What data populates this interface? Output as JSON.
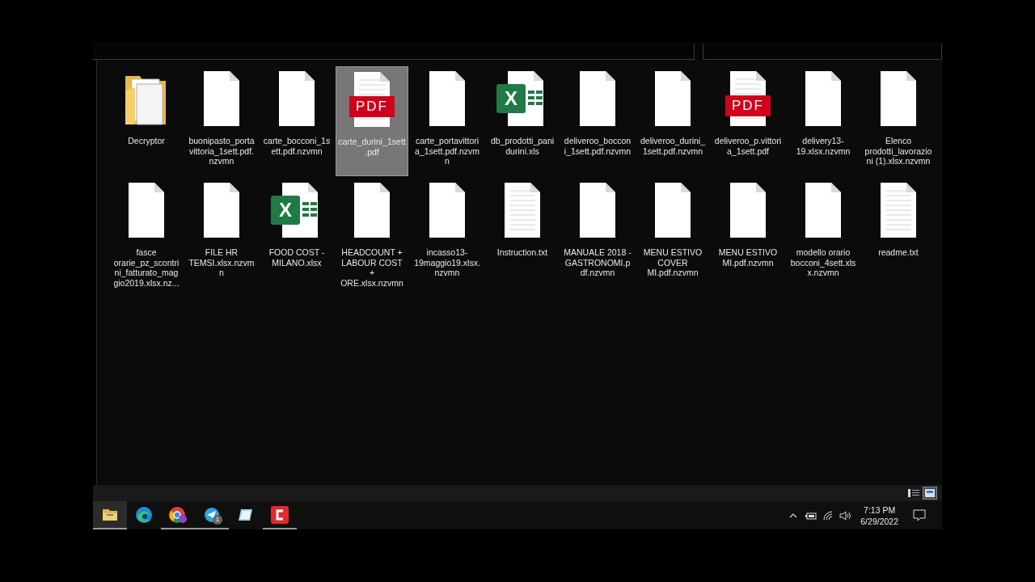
{
  "files": [
    {
      "name": "Decryptor",
      "kind": "folder",
      "selected": false
    },
    {
      "name": "buonipasto_portavittoria_1sett.pdf.nzvmn",
      "kind": "blank",
      "selected": false
    },
    {
      "name": "carte_bocconi_1sett.pdf.nzvmn",
      "kind": "blank",
      "selected": false
    },
    {
      "name": "carte_durini_1sett.pdf",
      "kind": "pdf",
      "icon_label": "PDF",
      "selected": true
    },
    {
      "name": "carte_portavittoria_1sett.pdf.nzvmn",
      "kind": "blank",
      "selected": false
    },
    {
      "name": "db_prodotti_panidurini.xls",
      "kind": "excel",
      "icon_label": "X",
      "selected": false
    },
    {
      "name": "deliveroo_bocconi_1sett.pdf.nzvmn",
      "kind": "blank",
      "selected": false
    },
    {
      "name": "deliveroo_durini_1sett.pdf.nzvmn",
      "kind": "blank",
      "selected": false
    },
    {
      "name": "deliveroo_p.vittoria_1sett.pdf",
      "kind": "pdf",
      "icon_label": "PDF",
      "selected": false
    },
    {
      "name": "delivery13-19.xlsx.nzvmn",
      "kind": "blank",
      "selected": false
    },
    {
      "name": "Elenco prodotti_lavorazioni (1).xlsx.nzvmn",
      "kind": "blank",
      "selected": false
    },
    {
      "name": "fasce orarie_pz_scontrini_fatturato_maggio2019.xlsx.nz...",
      "kind": "blank",
      "selected": false
    },
    {
      "name": "FILE HR TEMSI.xlsx.nzvmn",
      "kind": "blank",
      "selected": false
    },
    {
      "name": "FOOD COST - MILANO.xlsx",
      "kind": "excel",
      "icon_label": "X",
      "selected": false
    },
    {
      "name": "HEADCOUNT + LABOUR COST + ORE.xlsx.nzvmn",
      "kind": "blank",
      "selected": false
    },
    {
      "name": "incasso13-19maggio19.xlsx.nzvmn",
      "kind": "blank",
      "selected": false
    },
    {
      "name": "Instruction.txt",
      "kind": "text",
      "selected": false
    },
    {
      "name": "MANUALE 2018 - GASTRONOMI.pdf.nzvmn",
      "kind": "blank",
      "selected": false
    },
    {
      "name": "MENU ESTIVO COVER MI.pdf.nzvmn",
      "kind": "blank",
      "selected": false
    },
    {
      "name": "MENU ESTIVO MI.pdf.nzvmn",
      "kind": "blank",
      "selected": false
    },
    {
      "name": "modello orario bocconi_4sett.xlsx.nzvmn",
      "kind": "blank",
      "selected": false
    },
    {
      "name": "readme.txt",
      "kind": "text",
      "selected": false
    }
  ],
  "view_buttons": [
    {
      "kind": "details",
      "selected": false
    },
    {
      "kind": "large-icons",
      "selected": true
    }
  ],
  "taskbar": [
    {
      "kind": "explorer",
      "active": true,
      "running": true
    },
    {
      "kind": "edge",
      "active": false,
      "running": false
    },
    {
      "kind": "chrome",
      "active": false,
      "running": true
    },
    {
      "kind": "telegram",
      "active": false,
      "running": true,
      "badge": "1"
    },
    {
      "kind": "notepad",
      "active": false,
      "running": false
    },
    {
      "kind": "red-app",
      "active": false,
      "running": true
    }
  ],
  "clock": {
    "time": "7:13 PM",
    "date": "6/29/2022"
  }
}
